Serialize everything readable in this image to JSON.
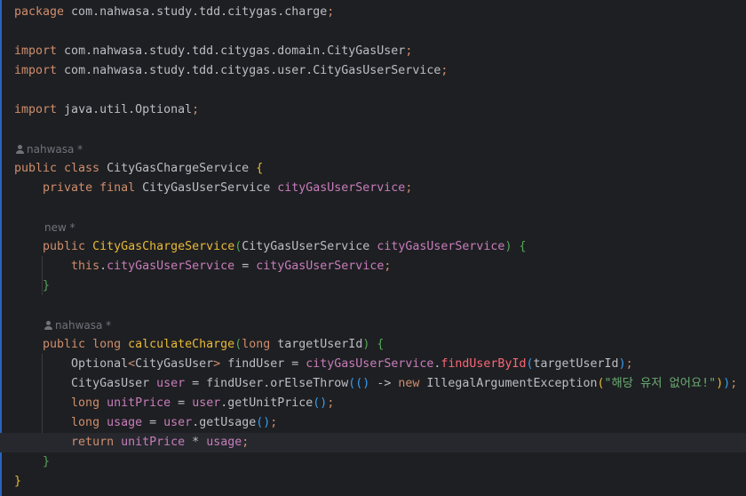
{
  "lines": [
    {
      "segs": [
        {
          "t": "package",
          "c": "kw"
        },
        {
          "t": " com.nahwasa.study.tdd.citygas.charge",
          "c": "ty"
        },
        {
          "t": ";",
          "c": "kw"
        }
      ]
    },
    {
      "segs": []
    },
    {
      "segs": [
        {
          "t": "import",
          "c": "kw"
        },
        {
          "t": " com.nahwasa.study.tdd.citygas.domain.CityGasUser",
          "c": "ty"
        },
        {
          "t": ";",
          "c": "kw"
        }
      ]
    },
    {
      "segs": [
        {
          "t": "import",
          "c": "kw"
        },
        {
          "t": " com.nahwasa.study.tdd.citygas.user.CityGasUserService",
          "c": "ty"
        },
        {
          "t": ";",
          "c": "kw"
        }
      ]
    },
    {
      "segs": []
    },
    {
      "segs": [
        {
          "t": "import",
          "c": "kw"
        },
        {
          "t": " java.util.Optional",
          "c": "ty"
        },
        {
          "t": ";",
          "c": "kw"
        }
      ]
    },
    {
      "segs": []
    },
    {
      "hint": "nahwasa *",
      "icon": true
    },
    {
      "segs": [
        {
          "t": "public class",
          "c": "kw"
        },
        {
          "t": " CityGasChargeService ",
          "c": "ty"
        },
        {
          "t": "{",
          "c": "brace-y"
        }
      ]
    },
    {
      "segs": [
        {
          "t": "    "
        },
        {
          "t": "private final",
          "c": "kw"
        },
        {
          "t": " CityGasUserService ",
          "c": "ty"
        },
        {
          "t": "cityGasUserService",
          "c": "fld"
        },
        {
          "t": ";",
          "c": "kw"
        }
      ]
    },
    {
      "segs": []
    },
    {
      "hint": "new *",
      "icon": false,
      "indent": 48
    },
    {
      "segs": [
        {
          "t": "    "
        },
        {
          "t": "public",
          "c": "kw"
        },
        {
          "t": " "
        },
        {
          "t": "CityGasChargeService",
          "c": "ctor"
        },
        {
          "t": "(",
          "c": "paren2"
        },
        {
          "t": "CityGasUserService ",
          "c": "ty"
        },
        {
          "t": "cityGasUserService",
          "c": "fld"
        },
        {
          "t": ")",
          "c": "paren2"
        },
        {
          "t": " "
        },
        {
          "t": "{",
          "c": "brace-g"
        }
      ]
    },
    {
      "segs": [
        {
          "t": "        "
        },
        {
          "t": "this",
          "c": "kw"
        },
        {
          "t": "."
        },
        {
          "t": "cityGasUserService",
          "c": "fld"
        },
        {
          "t": " = "
        },
        {
          "t": "cityGasUserService",
          "c": "fld"
        },
        {
          "t": ";",
          "c": "kw"
        }
      ]
    },
    {
      "segs": [
        {
          "t": "    "
        },
        {
          "t": "}",
          "c": "brace-g"
        }
      ]
    },
    {
      "segs": []
    },
    {
      "hint": "nahwasa *",
      "icon": true,
      "indent": 48
    },
    {
      "segs": [
        {
          "t": "    "
        },
        {
          "t": "public long",
          "c": "kw"
        },
        {
          "t": " "
        },
        {
          "t": "calculateCharge",
          "c": "ctor"
        },
        {
          "t": "(",
          "c": "paren2"
        },
        {
          "t": "long",
          "c": "kw"
        },
        {
          "t": " targetUserId",
          "c": "ty"
        },
        {
          "t": ")",
          "c": "paren2"
        },
        {
          "t": " "
        },
        {
          "t": "{",
          "c": "brace-g"
        }
      ]
    },
    {
      "segs": [
        {
          "t": "        "
        },
        {
          "t": "Optional",
          "c": "ty"
        },
        {
          "t": "<",
          "c": "kw"
        },
        {
          "t": "CityGasUser",
          "c": "ty"
        },
        {
          "t": ">",
          "c": "kw"
        },
        {
          "t": " findUser = "
        },
        {
          "t": "cityGasUserService",
          "c": "fld"
        },
        {
          "t": "."
        },
        {
          "t": "findUserById",
          "c": "meth-red"
        },
        {
          "t": "(",
          "c": "paren3"
        },
        {
          "t": "targetUserId"
        },
        {
          "t": ")",
          "c": "paren3"
        },
        {
          "t": ";",
          "c": "kw"
        }
      ]
    },
    {
      "segs": [
        {
          "t": "        "
        },
        {
          "t": "CityGasUser "
        },
        {
          "t": "user",
          "c": "fld"
        },
        {
          "t": " = findUser.orElseThrow"
        },
        {
          "t": "((",
          "c": "paren3"
        },
        {
          "t": ")",
          "c": "paren3"
        },
        {
          "t": " -> "
        },
        {
          "t": "new",
          "c": "kw"
        },
        {
          "t": " IllegalArgumentException"
        },
        {
          "t": "(",
          "c": "paren1"
        },
        {
          "t": "\"해당 유저 없어요!\"",
          "c": "str"
        },
        {
          "t": ")",
          "c": "paren1"
        },
        {
          "t": ")",
          "c": "paren3"
        },
        {
          "t": ";",
          "c": "kw"
        }
      ]
    },
    {
      "segs": [
        {
          "t": "        "
        },
        {
          "t": "long",
          "c": "kw"
        },
        {
          "t": " "
        },
        {
          "t": "unitPrice",
          "c": "fld"
        },
        {
          "t": " = "
        },
        {
          "t": "user",
          "c": "fld"
        },
        {
          "t": ".getUnitPrice"
        },
        {
          "t": "()",
          "c": "paren3"
        },
        {
          "t": ";",
          "c": "kw"
        }
      ]
    },
    {
      "segs": [
        {
          "t": "        "
        },
        {
          "t": "long",
          "c": "kw"
        },
        {
          "t": " "
        },
        {
          "t": "usage",
          "c": "fld"
        },
        {
          "t": " = "
        },
        {
          "t": "user",
          "c": "fld"
        },
        {
          "t": ".getUsage"
        },
        {
          "t": "()",
          "c": "paren3"
        },
        {
          "t": ";",
          "c": "kw"
        }
      ]
    },
    {
      "segs": [
        {
          "t": "        "
        },
        {
          "t": "return",
          "c": "kw"
        },
        {
          "t": " "
        },
        {
          "t": "unitPrice",
          "c": "fld"
        },
        {
          "t": " * "
        },
        {
          "t": "usage",
          "c": "fld"
        },
        {
          "t": ";",
          "c": "kw"
        }
      ],
      "current": true
    },
    {
      "segs": [
        {
          "t": "    "
        },
        {
          "t": "}",
          "c": "brace-g"
        }
      ]
    },
    {
      "segs": [
        {
          "t": "}",
          "c": "brace-y"
        }
      ]
    }
  ]
}
